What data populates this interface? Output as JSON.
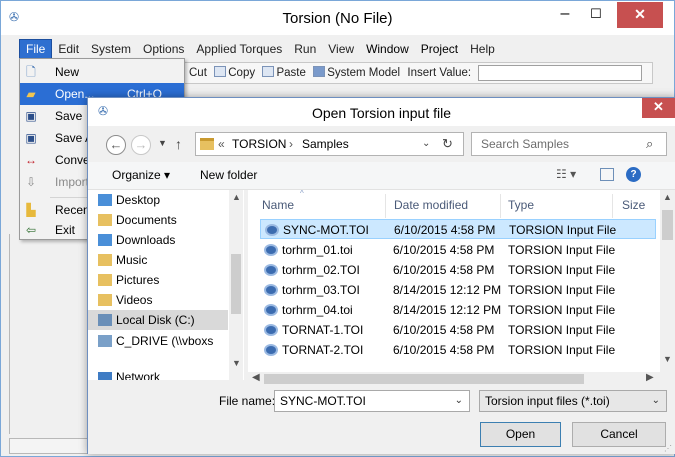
{
  "app": {
    "title": "Torsion (No File)",
    "menus": [
      "File",
      "Edit",
      "System",
      "Options",
      "Applied Torques",
      "Run",
      "View",
      "Window",
      "Project",
      "Help"
    ],
    "toolbar": {
      "cut": "Cut",
      "copy": "Copy",
      "paste": "Paste",
      "system_model": "System Model",
      "insert_value_label": "Insert Value:",
      "insert_value": ""
    },
    "window_buttons": {
      "minimize": "–",
      "maximize": "☐",
      "close": "✕"
    }
  },
  "file_menu": {
    "items": [
      {
        "label": "New",
        "shortcut": "",
        "icon": "new-file-icon",
        "state": "normal"
      },
      {
        "label": "Open...",
        "shortcut": "Ctrl+O",
        "icon": "open-folder-icon",
        "state": "highlight"
      },
      {
        "label": "Save",
        "shortcut": "",
        "icon": "save-icon",
        "state": "normal"
      },
      {
        "label": "Save A",
        "shortcut": "",
        "icon": "save-as-icon",
        "state": "normal"
      },
      {
        "label": "Conve",
        "shortcut": "",
        "icon": "convert-icon",
        "state": "normal"
      },
      {
        "label": "Import",
        "shortcut": "",
        "icon": "import-icon",
        "state": "disabled"
      },
      {
        "label": "Recent",
        "shortcut": "",
        "icon": "recent-icon",
        "state": "normal"
      },
      {
        "label": "Exit",
        "shortcut": "",
        "icon": "exit-icon",
        "state": "normal"
      }
    ]
  },
  "dialog": {
    "title": "Open Torsion input file",
    "close": "✕",
    "breadcrumb": {
      "prefix": "«",
      "parts": [
        "TORSION",
        "Samples"
      ],
      "separator": "›"
    },
    "search_placeholder": "Search Samples",
    "organize": "Organize ▾",
    "new_folder": "New folder",
    "nav_tree": [
      {
        "label": "Desktop",
        "icon": "desktop-folder-icon",
        "color": "#4a8fd8"
      },
      {
        "label": "Documents",
        "icon": "documents-folder-icon",
        "color": "#e7c060"
      },
      {
        "label": "Downloads",
        "icon": "downloads-folder-icon",
        "color": "#4a8fd8"
      },
      {
        "label": "Music",
        "icon": "music-folder-icon",
        "color": "#e7c060"
      },
      {
        "label": "Pictures",
        "icon": "pictures-folder-icon",
        "color": "#e7c060"
      },
      {
        "label": "Videos",
        "icon": "videos-folder-icon",
        "color": "#e7c060"
      },
      {
        "label": "Local Disk (C:)",
        "icon": "local-disk-icon",
        "color": "#6a8fb8"
      },
      {
        "label": "C_DRIVE (\\\\vboxs",
        "icon": "network-drive-icon",
        "color": "#7aa0c8"
      },
      {
        "label": "Network",
        "icon": "network-icon",
        "color": "#3f7cc4"
      }
    ],
    "columns": {
      "name": "Name",
      "date": "Date modified",
      "type": "Type",
      "size": "Size"
    },
    "files": [
      {
        "name": "SYNC-MOT.TOI",
        "date": "6/10/2015 4:58 PM",
        "type": "TORSION Input File"
      },
      {
        "name": "torhrm_01.toi",
        "date": "6/10/2015 4:58 PM",
        "type": "TORSION Input File"
      },
      {
        "name": "torhrm_02.TOI",
        "date": "6/10/2015 4:58 PM",
        "type": "TORSION Input File"
      },
      {
        "name": "torhrm_03.TOI",
        "date": "8/14/2015 12:12 PM",
        "type": "TORSION Input File"
      },
      {
        "name": "torhrm_04.toi",
        "date": "8/14/2015 12:12 PM",
        "type": "TORSION Input File"
      },
      {
        "name": "TORNAT-1.TOI",
        "date": "6/10/2015 4:58 PM",
        "type": "TORSION Input File"
      },
      {
        "name": "TORNAT-2.TOI",
        "date": "6/10/2015 4:58 PM",
        "type": "TORSION Input File"
      }
    ],
    "file_name_label": "File name:",
    "file_name_value": "SYNC-MOT.TOI",
    "filter": "Torsion input files (*.toi)",
    "open_button": "Open",
    "cancel_button": "Cancel"
  }
}
